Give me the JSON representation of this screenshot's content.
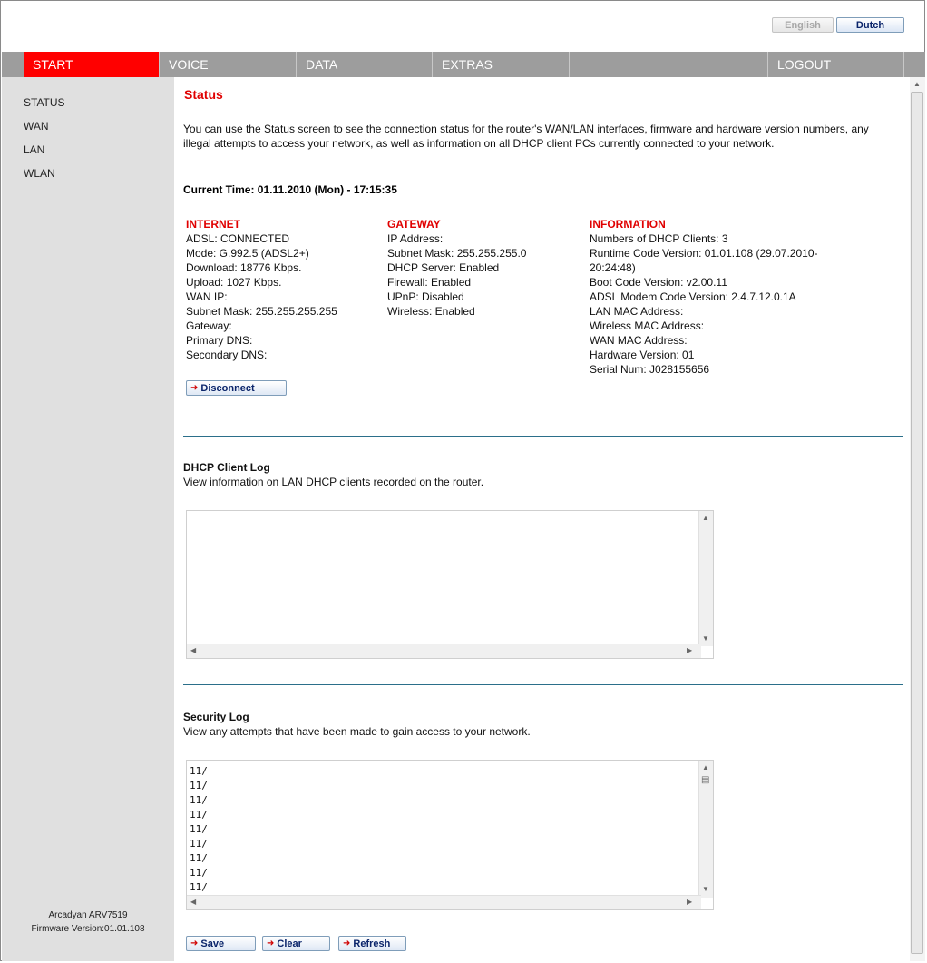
{
  "lang": {
    "english": "English",
    "dutch": "Dutch"
  },
  "nav": {
    "start": "START",
    "voice": "VOICE",
    "data": "DATA",
    "extras": "EXTRAS",
    "logout": "LOGOUT"
  },
  "sidebar": {
    "items": [
      "STATUS",
      "WAN",
      "LAN",
      "WLAN"
    ],
    "model": "Arcadyan ARV7519",
    "firmware": "Firmware Version:01.01.108"
  },
  "status": {
    "title": "Status",
    "intro": "You can use the Status screen to see the connection status for the router's WAN/LAN interfaces, firmware and hardware version numbers, any illegal attempts to access your network, as well as information on all DHCP client PCs currently connected to your network.",
    "current_time": "Current Time: 01.11.2010 (Mon) - 17:15:35"
  },
  "internet": {
    "header": "INTERNET",
    "lines": [
      "ADSL:  CONNECTED",
      "Mode:  G.992.5 (ADSL2+)",
      "Download:  18776 Kbps.",
      "Upload:  1027 Kbps.",
      "WAN IP:",
      "Subnet Mask:  255.255.255.255",
      "Gateway:",
      "Primary DNS:",
      "Secondary DNS:"
    ]
  },
  "gateway": {
    "header": "GATEWAY",
    "lines": [
      "IP Address:",
      "Subnet Mask:  255.255.255.0",
      "DHCP Server:  Enabled",
      "Firewall:  Enabled",
      "UPnP:  Disabled",
      "Wireless:  Enabled"
    ]
  },
  "information": {
    "header": "INFORMATION",
    "lines": [
      "Numbers of DHCP Clients:  3",
      "Runtime Code Version:  01.01.108 (29.07.2010-",
      "20:24:48)",
      "Boot Code Version:  v2.00.11",
      "ADSL Modem Code Version:  2.4.7.12.0.1A",
      "LAN MAC Address:",
      "Wireless MAC Address:",
      "WAN MAC Address:",
      "Hardware Version:  01",
      "Serial Num:    J028155656"
    ]
  },
  "buttons": {
    "disconnect": "Disconnect",
    "save": "Save",
    "clear": "Clear",
    "refresh": "Refresh"
  },
  "dhcp": {
    "title": "DHCP Client Log",
    "desc": "View information on LAN DHCP clients recorded on the router."
  },
  "security": {
    "title": "Security Log",
    "desc": "View any attempts that have been made to gain access to your network.",
    "lines": [
      "11/",
      "11/",
      "11/",
      "11/",
      "11/",
      "11/",
      "11/",
      "11/",
      "11/"
    ]
  }
}
